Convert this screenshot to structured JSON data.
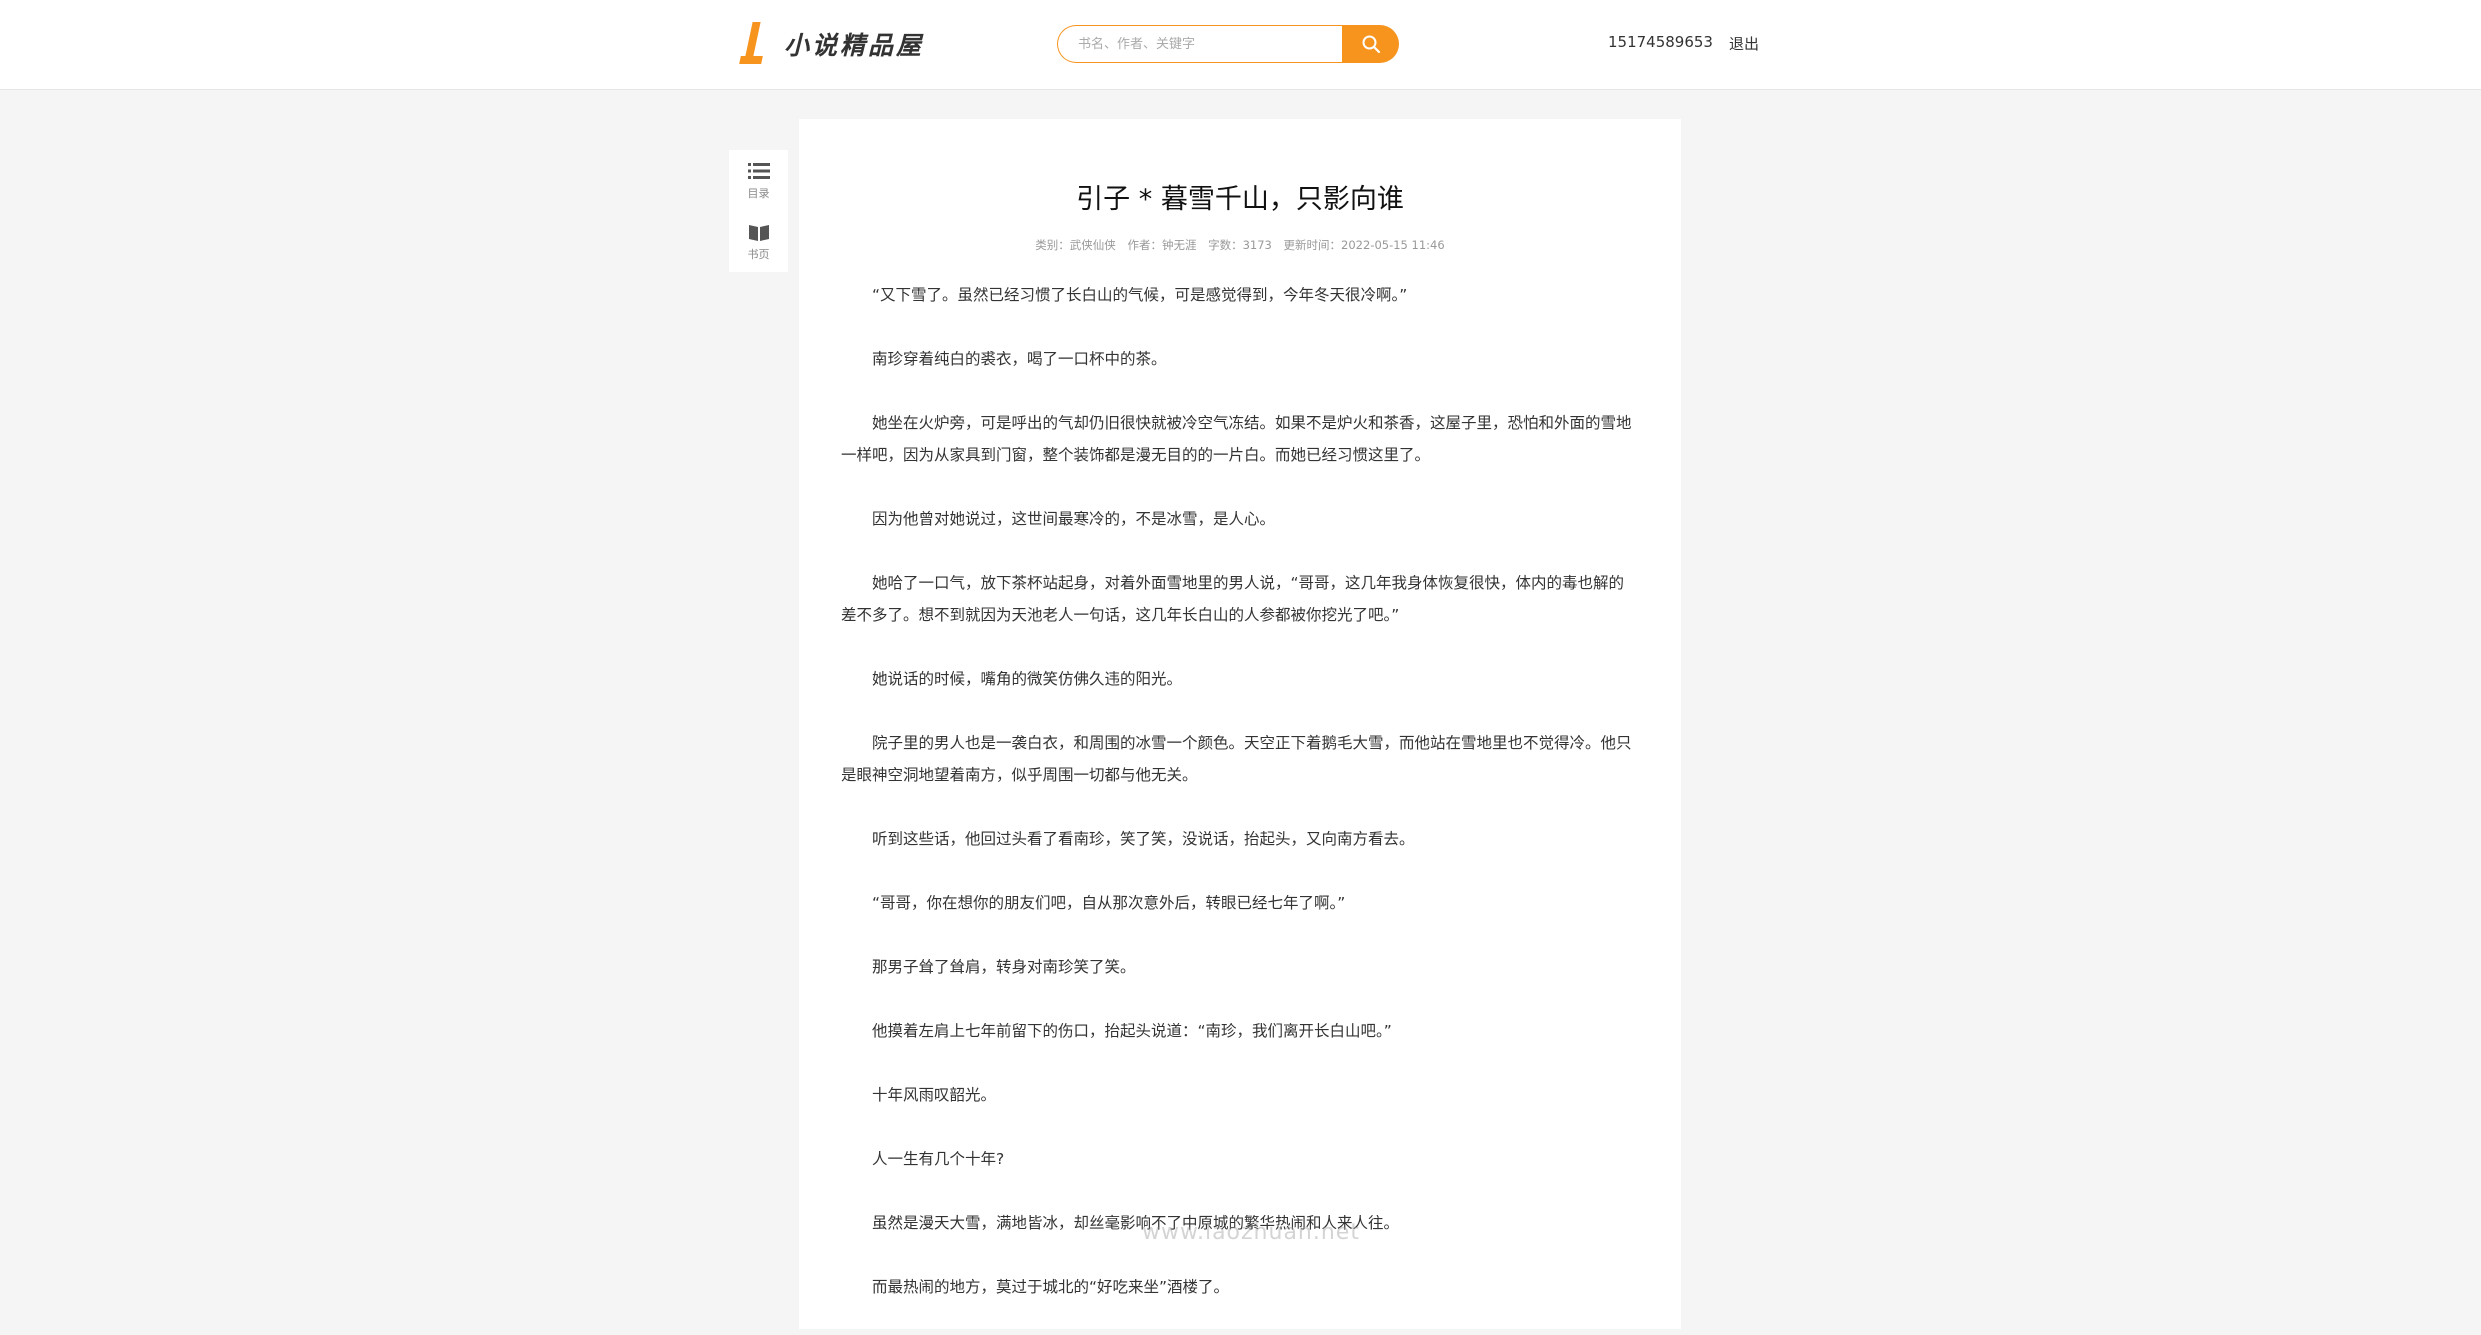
{
  "brand": {
    "logo_text": "小说精品屋",
    "accent": "#f7941d"
  },
  "search": {
    "placeholder": "书名、作者、关键字",
    "icon": "search-icon"
  },
  "user": {
    "account": "15174589653",
    "logout": "退出"
  },
  "side_tools": [
    {
      "label": "目录",
      "icon": "list-icon"
    },
    {
      "label": "书页",
      "icon": "book-icon"
    }
  ],
  "chapter": {
    "title": "引子 * 暮雪千山，只影向谁",
    "meta": {
      "category": "类别：武侠仙侠",
      "author": "作者：钟无涯",
      "word_count": "字数：3173",
      "updated": "更新时间：2022-05-15 11:46"
    },
    "paragraphs": [
      "“又下雪了。虽然已经习惯了长白山的气候，可是感觉得到，今年冬天很冷啊。”",
      "南珍穿着纯白的裘衣，喝了一口杯中的茶。",
      "她坐在火炉旁，可是呼出的气却仍旧很快就被冷空气冻结。如果不是炉火和茶香，这屋子里，恐怕和外面的雪地一样吧，因为从家具到门窗，整个装饰都是漫无目的的一片白。而她已经习惯这里了。",
      "因为他曾对她说过，这世间最寒冷的，不是冰雪，是人心。",
      "她哈了一口气，放下茶杯站起身，对着外面雪地里的男人说，“哥哥，这几年我身体恢复很快，体内的毒也解的差不多了。想不到就因为天池老人一句话，这几年长白山的人参都被你挖光了吧。”",
      "她说话的时候，嘴角的微笑仿佛久违的阳光。",
      "院子里的男人也是一袭白衣，和周围的冰雪一个颜色。天空正下着鹅毛大雪，而他站在雪地里也不觉得冷。他只是眼神空洞地望着南方，似乎周围一切都与他无关。",
      "听到这些话，他回过头看了看南珍，笑了笑，没说话，抬起头，又向南方看去。",
      "“哥哥，你在想你的朋友们吧，自从那次意外后，转眼已经七年了啊。”",
      "那男子耸了耸肩，转身对南珍笑了笑。",
      "他摸着左肩上七年前留下的伤口，抬起头说道：“南珍，我们离开长白山吧。”",
      "十年风雨叹韶光。",
      "人一生有几个十年?",
      "虽然是漫天大雪，满地皆冰，却丝毫影响不了中原城的繁华热闹和人来人往。",
      "而最热闹的地方，莫过于城北的“好吃来坐”酒楼了。"
    ]
  },
  "watermark": "www.laozhuan.net"
}
